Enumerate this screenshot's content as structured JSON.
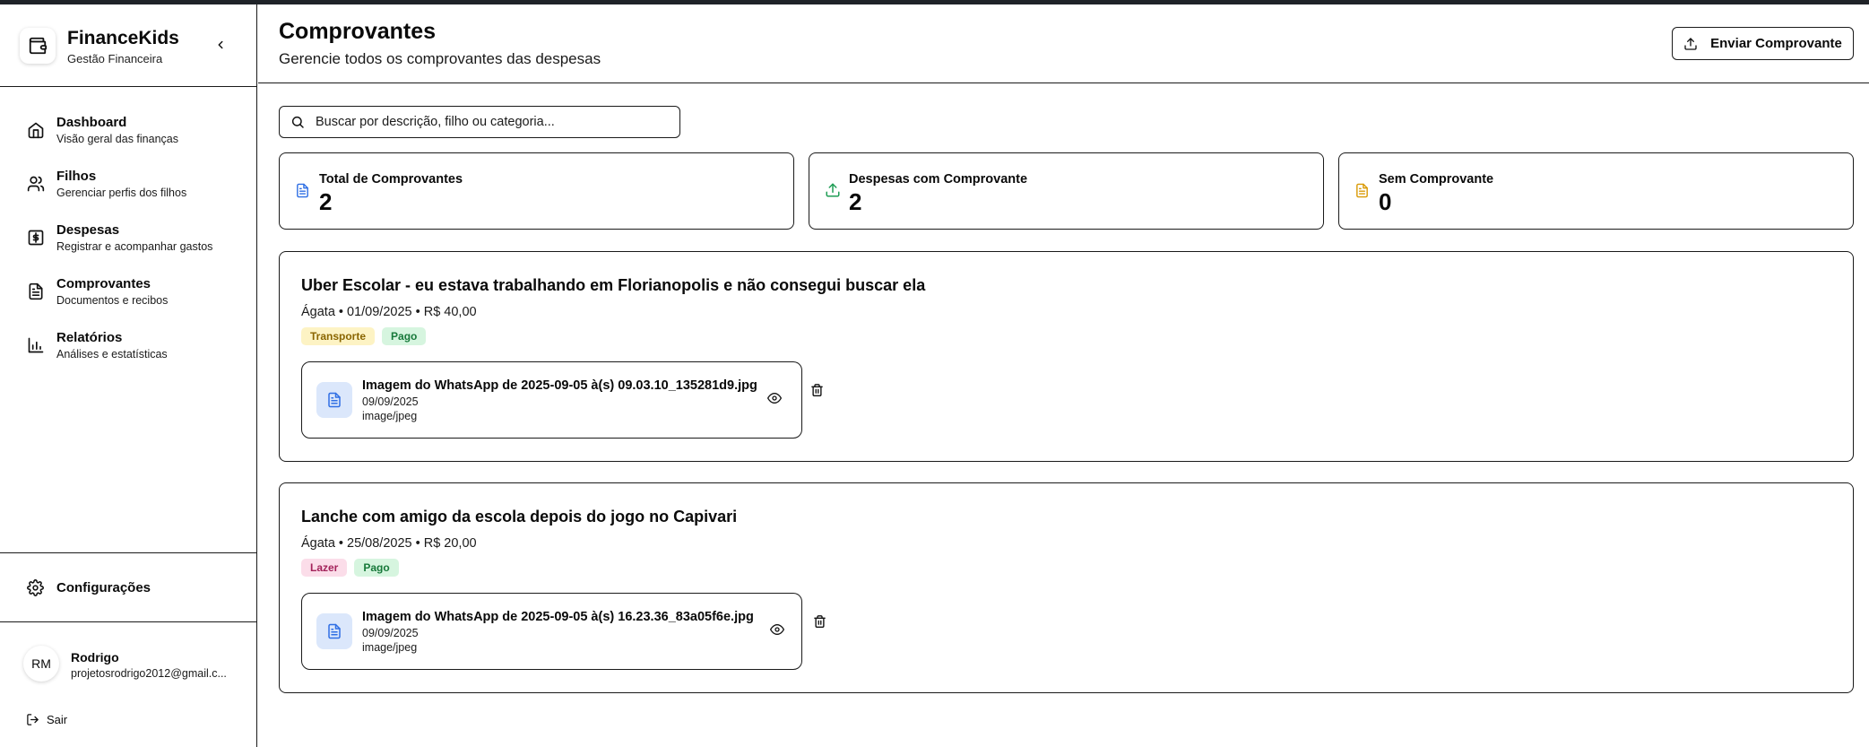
{
  "brand": {
    "name": "FinanceKids",
    "subtitle": "Gestão Financeira"
  },
  "sidebar": {
    "items": [
      {
        "label": "Dashboard",
        "description": "Visão geral das finanças",
        "icon": "home-icon"
      },
      {
        "label": "Filhos",
        "description": "Gerenciar perfis dos filhos",
        "icon": "users-icon"
      },
      {
        "label": "Despesas",
        "description": "Registrar e acompanhar gastos",
        "icon": "receipt-dollar-icon"
      },
      {
        "label": "Comprovantes",
        "description": "Documentos e recibos",
        "icon": "file-text-icon"
      },
      {
        "label": "Relatórios",
        "description": "Análises e estatísticas",
        "icon": "bar-chart-icon"
      }
    ],
    "settings_label": "Configurações",
    "user": {
      "initials": "RM",
      "name": "Rodrigo",
      "email": "projetosrodrigo2012@gmail.c..."
    },
    "logout_label": "Sair"
  },
  "header": {
    "title": "Comprovantes",
    "subtitle": "Gerencie todos os comprovantes das despesas",
    "upload_label": "Enviar Comprovante"
  },
  "search": {
    "placeholder": "Buscar por descrição, filho ou categoria..."
  },
  "stats": [
    {
      "label": "Total de Comprovantes",
      "value": "2",
      "icon": "file-text-icon",
      "color": "#2f6fe4"
    },
    {
      "label": "Despesas com Comprovante",
      "value": "2",
      "icon": "upload-icon",
      "color": "#1f9d55"
    },
    {
      "label": "Sem Comprovante",
      "value": "0",
      "icon": "file-text-icon",
      "color": "#d99a06"
    }
  ],
  "expenses": [
    {
      "title": "Uber Escolar - eu estava trabalhando em Florianopolis e não consegui buscar ela",
      "meta": "Ágata • 01/09/2025 • R$ 40,00",
      "badges": [
        {
          "label": "Transporte",
          "bg": "#fdf3c4",
          "color": "#8a6500"
        },
        {
          "label": "Pago",
          "bg": "#d6f5df",
          "color": "#17793a"
        }
      ],
      "file": {
        "name": "Imagem do WhatsApp de 2025-09-05 à(s) 09.03.10_135281d9.jpg",
        "date": "09/09/2025",
        "type": "image/jpeg"
      }
    },
    {
      "title": "Lanche com amigo da escola depois do jogo no Capivari",
      "meta": "Ágata • 25/08/2025 • R$ 20,00",
      "badges": [
        {
          "label": "Lazer",
          "bg": "#fbdde9",
          "color": "#a3225a"
        },
        {
          "label": "Pago",
          "bg": "#d6f5df",
          "color": "#17793a"
        }
      ],
      "file": {
        "name": "Imagem do WhatsApp de 2025-09-05 à(s) 16.23.36_83a05f6e.jpg",
        "date": "09/09/2025",
        "type": "image/jpeg"
      }
    }
  ]
}
